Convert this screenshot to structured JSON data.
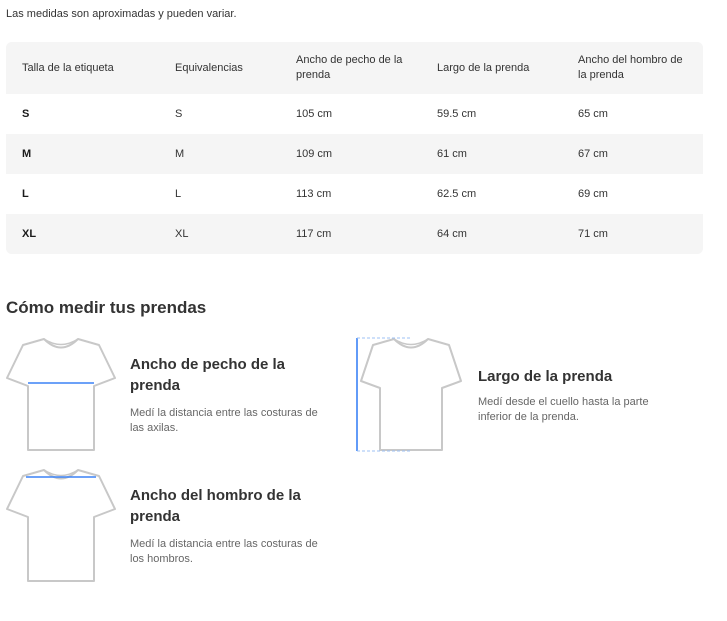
{
  "note": "Las medidas son aproximadas y pueden variar.",
  "table": {
    "headers": [
      "Talla de la etiqueta",
      "Equivalencias",
      "Ancho de pecho de la prenda",
      "Largo de la prenda",
      "Ancho del hombro de la prenda"
    ],
    "rows": [
      [
        "S",
        "S",
        "105 cm",
        "59.5 cm",
        "65 cm"
      ],
      [
        "M",
        "M",
        "109 cm",
        "61 cm",
        "67 cm"
      ],
      [
        "L",
        "L",
        "113 cm",
        "62.5 cm",
        "69 cm"
      ],
      [
        "XL",
        "XL",
        "117 cm",
        "64 cm",
        "71 cm"
      ]
    ]
  },
  "guide": {
    "title": "Cómo medir tus prendas",
    "items": [
      {
        "title": "Ancho de pecho de la prenda",
        "description": "Medí la distancia entre las costuras de las axilas.",
        "icon": "tshirt-chest-icon"
      },
      {
        "title": "Largo de la prenda",
        "description": "Medí desde el cuello hasta la parte inferior de la prenda.",
        "icon": "tshirt-length-icon"
      },
      {
        "title": "Ancho del hombro de la prenda",
        "description": "Medí la distancia entre las costuras de los hombros.",
        "icon": "tshirt-shoulder-icon"
      }
    ]
  },
  "colors": {
    "table_background": "#f5f5f5",
    "measure_line": "#3b82f6",
    "shirt_outline": "#c8c8c8"
  }
}
